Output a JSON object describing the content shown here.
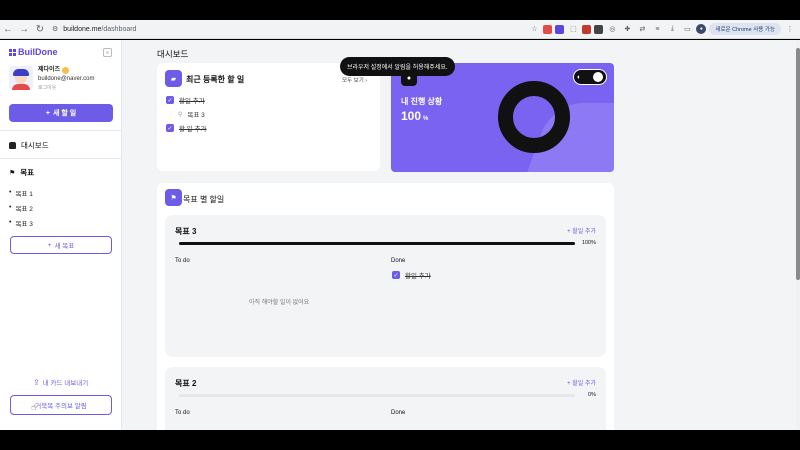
{
  "browser": {
    "url_domain": "buildone.me",
    "url_path": "/dashboard",
    "update_label": "새로운 Chrome 사용 가능"
  },
  "sidebar": {
    "logo": "BuilDone",
    "user": {
      "name": "제다이즈",
      "email": "buildone@naver.com",
      "logout": "로그아웃"
    },
    "new_task_label": "새 할 일",
    "dashboard_label": "대시보드",
    "goals_label": "목표",
    "goals": [
      "목표 1",
      "목표 2",
      "목표 3"
    ],
    "new_goal_label": "새 목표",
    "export_label": "내 카드 내보내기",
    "feedback_label": "거북목 주의보 알림"
  },
  "main": {
    "page_title": "대시보드",
    "recent": {
      "title": "최근 등록한 할 일",
      "see_all": "모두 보기",
      "items": [
        {
          "label": "할일 추가",
          "done": true
        },
        {
          "label": "목표 3",
          "sub": true
        },
        {
          "label": "할 일 추가",
          "done": true
        }
      ]
    },
    "toast": "브라우저 설정에서 알림을 허용해주세요.",
    "progress": {
      "title": "내 진행 상황",
      "value": "100",
      "unit": "%"
    },
    "goals_section": {
      "title": "목표 별 할일",
      "panels": [
        {
          "title": "목표 3",
          "add_label": "할일 추가",
          "percent_text": "100%",
          "percent": 100,
          "todo_label": "To do",
          "done_label": "Done",
          "empty_msg": "아직 해야할 일이 없어요",
          "done_items": [
            "할일 추가"
          ]
        },
        {
          "title": "목표 2",
          "add_label": "할일 추가",
          "percent_text": "0%",
          "percent": 0,
          "todo_label": "To do",
          "done_label": "Done"
        }
      ]
    }
  }
}
